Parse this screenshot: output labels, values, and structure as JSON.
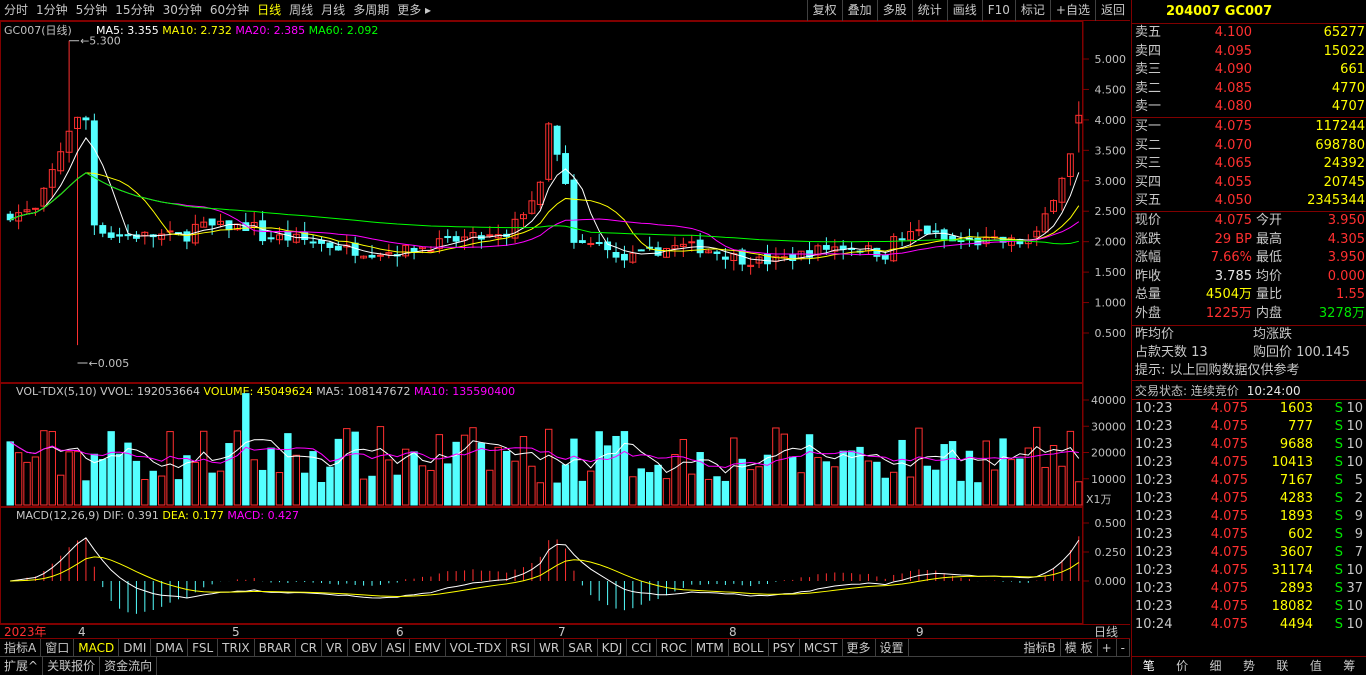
{
  "topbar": {
    "timeframes": [
      "分时",
      "1分钟",
      "5分钟",
      "15分钟",
      "30分钟",
      "60分钟",
      "日线",
      "周线",
      "月线",
      "多周期",
      "更多"
    ],
    "active": "日线",
    "tools": [
      "复权",
      "叠加",
      "多股",
      "统计",
      "画线",
      "F10",
      "标记",
      "+自选",
      "返回"
    ]
  },
  "main": {
    "title": "GC007(日线)",
    "ma_labels": [
      {
        "text": "MA5: 3.355",
        "color": "#ffffff"
      },
      {
        "text": "MA10: 2.732",
        "color": "#ffff00"
      },
      {
        "text": "MA20: 2.385",
        "color": "#ff00ff"
      },
      {
        "text": "MA60: 2.092",
        "color": "#00ff00"
      }
    ],
    "y_ticks": [
      "5.000",
      "4.500",
      "4.000",
      "3.500",
      "3.000",
      "2.500",
      "2.000",
      "1.500",
      "1.000",
      "0.500"
    ],
    "high_label": "5.300",
    "low_label": "0.005"
  },
  "vol": {
    "labels": [
      {
        "text": "VOL-TDX(5,10)",
        "color": "#c8c8c8"
      },
      {
        "text": "VVOL: 192053664",
        "color": "#c8c8c8"
      },
      {
        "text": "VOLUME: 45049624",
        "color": "#ffff00"
      },
      {
        "text": "MA5: 108147672",
        "color": "#c8c8c8"
      },
      {
        "text": "MA10: 135590400",
        "color": "#ff00ff"
      }
    ],
    "y_ticks": [
      "40000",
      "30000",
      "20000",
      "10000"
    ],
    "unit": "X1万"
  },
  "macd": {
    "labels": [
      {
        "text": "MACD(12,26,9)",
        "color": "#c8c8c8"
      },
      {
        "text": "DIF: 0.391",
        "color": "#c8c8c8"
      },
      {
        "text": "DEA: 0.177",
        "color": "#ffff00"
      },
      {
        "text": "MACD: 0.427",
        "color": "#ff00ff"
      }
    ],
    "y_ticks": [
      "0.500",
      "0.250",
      "0.000"
    ]
  },
  "dates": {
    "year": "2023年",
    "months": [
      "4",
      "5",
      "6",
      "7",
      "8",
      "9"
    ],
    "tab": "日线"
  },
  "indicators": {
    "items": [
      "指标A",
      "窗口",
      "MACD",
      "DMI",
      "DMA",
      "FSL",
      "TRIX",
      "BRAR",
      "CR",
      "VR",
      "OBV",
      "ASI",
      "EMV",
      "VOL-TDX",
      "RSI",
      "WR",
      "SAR",
      "KDJ",
      "CCI",
      "ROC",
      "MTM",
      "BOLL",
      "PSY",
      "MCST",
      "更多",
      "设置"
    ],
    "active": "MACD",
    "right": [
      "指标B",
      "模 板",
      "+",
      "-"
    ]
  },
  "bottom": [
    "扩展^",
    "关联报价",
    "资金流向"
  ],
  "panel": {
    "title": "204007 GC007",
    "sell": [
      {
        "label": "卖五",
        "price": "4.100",
        "vol": "65277"
      },
      {
        "label": "卖四",
        "price": "4.095",
        "vol": "15022"
      },
      {
        "label": "卖三",
        "price": "4.090",
        "vol": "661"
      },
      {
        "label": "卖二",
        "price": "4.085",
        "vol": "4770"
      },
      {
        "label": "卖一",
        "price": "4.080",
        "vol": "4707"
      }
    ],
    "buy": [
      {
        "label": "买一",
        "price": "4.075",
        "vol": "117244"
      },
      {
        "label": "买二",
        "price": "4.070",
        "vol": "698780"
      },
      {
        "label": "买三",
        "price": "4.065",
        "vol": "24392"
      },
      {
        "label": "买四",
        "price": "4.055",
        "vol": "20745"
      },
      {
        "label": "买五",
        "price": "4.050",
        "vol": "2345344"
      }
    ],
    "quote": [
      {
        "l1": "现价",
        "v1": "4.075",
        "c1": "red",
        "l2": "今开",
        "v2": "3.950",
        "c2": "red"
      },
      {
        "l1": "涨跌",
        "v1": "29 BP",
        "c1": "red",
        "l2": "最高",
        "v2": "4.305",
        "c2": "red"
      },
      {
        "l1": "涨幅",
        "v1": "7.66%",
        "c1": "red",
        "l2": "最低",
        "v2": "3.950",
        "c2": "red"
      },
      {
        "l1": "昨收",
        "v1": "3.785",
        "c1": "wht",
        "l2": "均价",
        "v2": "0.000",
        "c2": "red"
      },
      {
        "l1": "总量",
        "v1": "4504万",
        "c1": "yel",
        "l2": "量比",
        "v2": "1.55",
        "c2": "red"
      },
      {
        "l1": "外盘",
        "v1": "1225万",
        "c1": "red",
        "l2": "内盘",
        "v2": "3278万",
        "c2": "grn"
      }
    ],
    "info": [
      {
        "a": "昨均价",
        "b": "均涨跌"
      },
      {
        "a": "占款天数 13",
        "b": "购回价 100.145"
      }
    ],
    "note": "提示: 以上回购数据仅供参考",
    "status_label": "交易状态: 连续竞价",
    "status_time": "10:24:00",
    "ticks": [
      {
        "t": "10:23",
        "p": "4.075",
        "v": "1603",
        "s": "S",
        "n": "10"
      },
      {
        "t": "10:23",
        "p": "4.075",
        "v": "777",
        "s": "S",
        "n": "10"
      },
      {
        "t": "10:23",
        "p": "4.075",
        "v": "9688",
        "s": "S",
        "n": "10"
      },
      {
        "t": "10:23",
        "p": "4.075",
        "v": "10413",
        "s": "S",
        "n": "10"
      },
      {
        "t": "10:23",
        "p": "4.075",
        "v": "7167",
        "s": "S",
        "n": "5"
      },
      {
        "t": "10:23",
        "p": "4.075",
        "v": "4283",
        "s": "S",
        "n": "2"
      },
      {
        "t": "10:23",
        "p": "4.075",
        "v": "1893",
        "s": "S",
        "n": "9"
      },
      {
        "t": "10:23",
        "p": "4.075",
        "v": "602",
        "s": "S",
        "n": "9"
      },
      {
        "t": "10:23",
        "p": "4.075",
        "v": "3607",
        "s": "S",
        "n": "7"
      },
      {
        "t": "10:23",
        "p": "4.075",
        "v": "31174",
        "s": "S",
        "n": "10"
      },
      {
        "t": "10:23",
        "p": "4.075",
        "v": "2893",
        "s": "S",
        "n": "37"
      },
      {
        "t": "10:23",
        "p": "4.075",
        "v": "18082",
        "s": "S",
        "n": "10"
      },
      {
        "t": "10:24",
        "p": "4.075",
        "v": "4494",
        "s": "S",
        "n": "10"
      }
    ],
    "tabs": [
      "笔",
      "价",
      "细",
      "势",
      "联",
      "值",
      "筹"
    ]
  },
  "colors": {
    "up": "#ff3030",
    "down": "#54ffff",
    "frame": "#800000"
  }
}
